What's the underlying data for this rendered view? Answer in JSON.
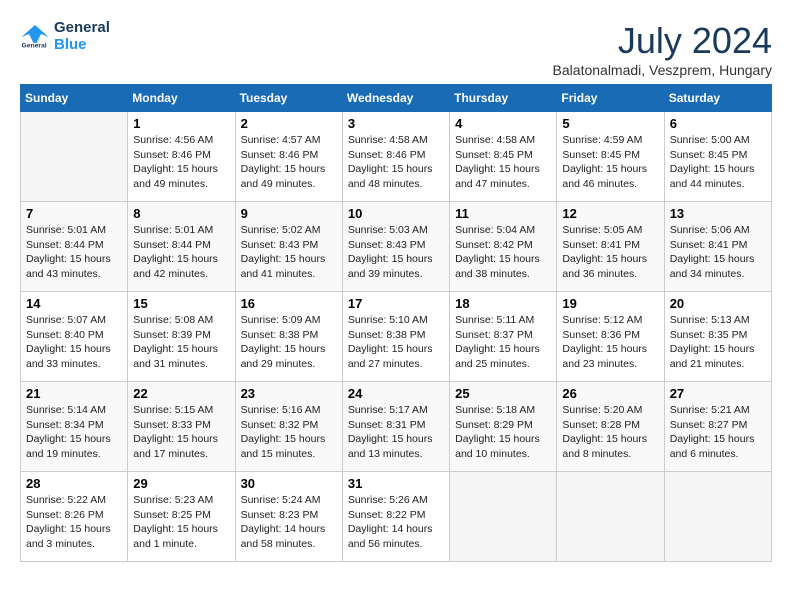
{
  "app": {
    "name": "GeneralBlue",
    "logo_color": "#2196F3"
  },
  "header": {
    "title": "July 2024",
    "subtitle": "Balatonalmadi, Veszprem, Hungary"
  },
  "calendar": {
    "days_of_week": [
      "Sunday",
      "Monday",
      "Tuesday",
      "Wednesday",
      "Thursday",
      "Friday",
      "Saturday"
    ],
    "weeks": [
      [
        {
          "day": "",
          "info": ""
        },
        {
          "day": "1",
          "info": "Sunrise: 4:56 AM\nSunset: 8:46 PM\nDaylight: 15 hours\nand 49 minutes."
        },
        {
          "day": "2",
          "info": "Sunrise: 4:57 AM\nSunset: 8:46 PM\nDaylight: 15 hours\nand 49 minutes."
        },
        {
          "day": "3",
          "info": "Sunrise: 4:58 AM\nSunset: 8:46 PM\nDaylight: 15 hours\nand 48 minutes."
        },
        {
          "day": "4",
          "info": "Sunrise: 4:58 AM\nSunset: 8:45 PM\nDaylight: 15 hours\nand 47 minutes."
        },
        {
          "day": "5",
          "info": "Sunrise: 4:59 AM\nSunset: 8:45 PM\nDaylight: 15 hours\nand 46 minutes."
        },
        {
          "day": "6",
          "info": "Sunrise: 5:00 AM\nSunset: 8:45 PM\nDaylight: 15 hours\nand 44 minutes."
        }
      ],
      [
        {
          "day": "7",
          "info": "Sunrise: 5:01 AM\nSunset: 8:44 PM\nDaylight: 15 hours\nand 43 minutes."
        },
        {
          "day": "8",
          "info": "Sunrise: 5:01 AM\nSunset: 8:44 PM\nDaylight: 15 hours\nand 42 minutes."
        },
        {
          "day": "9",
          "info": "Sunrise: 5:02 AM\nSunset: 8:43 PM\nDaylight: 15 hours\nand 41 minutes."
        },
        {
          "day": "10",
          "info": "Sunrise: 5:03 AM\nSunset: 8:43 PM\nDaylight: 15 hours\nand 39 minutes."
        },
        {
          "day": "11",
          "info": "Sunrise: 5:04 AM\nSunset: 8:42 PM\nDaylight: 15 hours\nand 38 minutes."
        },
        {
          "day": "12",
          "info": "Sunrise: 5:05 AM\nSunset: 8:41 PM\nDaylight: 15 hours\nand 36 minutes."
        },
        {
          "day": "13",
          "info": "Sunrise: 5:06 AM\nSunset: 8:41 PM\nDaylight: 15 hours\nand 34 minutes."
        }
      ],
      [
        {
          "day": "14",
          "info": "Sunrise: 5:07 AM\nSunset: 8:40 PM\nDaylight: 15 hours\nand 33 minutes."
        },
        {
          "day": "15",
          "info": "Sunrise: 5:08 AM\nSunset: 8:39 PM\nDaylight: 15 hours\nand 31 minutes."
        },
        {
          "day": "16",
          "info": "Sunrise: 5:09 AM\nSunset: 8:38 PM\nDaylight: 15 hours\nand 29 minutes."
        },
        {
          "day": "17",
          "info": "Sunrise: 5:10 AM\nSunset: 8:38 PM\nDaylight: 15 hours\nand 27 minutes."
        },
        {
          "day": "18",
          "info": "Sunrise: 5:11 AM\nSunset: 8:37 PM\nDaylight: 15 hours\nand 25 minutes."
        },
        {
          "day": "19",
          "info": "Sunrise: 5:12 AM\nSunset: 8:36 PM\nDaylight: 15 hours\nand 23 minutes."
        },
        {
          "day": "20",
          "info": "Sunrise: 5:13 AM\nSunset: 8:35 PM\nDaylight: 15 hours\nand 21 minutes."
        }
      ],
      [
        {
          "day": "21",
          "info": "Sunrise: 5:14 AM\nSunset: 8:34 PM\nDaylight: 15 hours\nand 19 minutes."
        },
        {
          "day": "22",
          "info": "Sunrise: 5:15 AM\nSunset: 8:33 PM\nDaylight: 15 hours\nand 17 minutes."
        },
        {
          "day": "23",
          "info": "Sunrise: 5:16 AM\nSunset: 8:32 PM\nDaylight: 15 hours\nand 15 minutes."
        },
        {
          "day": "24",
          "info": "Sunrise: 5:17 AM\nSunset: 8:31 PM\nDaylight: 15 hours\nand 13 minutes."
        },
        {
          "day": "25",
          "info": "Sunrise: 5:18 AM\nSunset: 8:29 PM\nDaylight: 15 hours\nand 10 minutes."
        },
        {
          "day": "26",
          "info": "Sunrise: 5:20 AM\nSunset: 8:28 PM\nDaylight: 15 hours\nand 8 minutes."
        },
        {
          "day": "27",
          "info": "Sunrise: 5:21 AM\nSunset: 8:27 PM\nDaylight: 15 hours\nand 6 minutes."
        }
      ],
      [
        {
          "day": "28",
          "info": "Sunrise: 5:22 AM\nSunset: 8:26 PM\nDaylight: 15 hours\nand 3 minutes."
        },
        {
          "day": "29",
          "info": "Sunrise: 5:23 AM\nSunset: 8:25 PM\nDaylight: 15 hours\nand 1 minute."
        },
        {
          "day": "30",
          "info": "Sunrise: 5:24 AM\nSunset: 8:23 PM\nDaylight: 14 hours\nand 58 minutes."
        },
        {
          "day": "31",
          "info": "Sunrise: 5:26 AM\nSunset: 8:22 PM\nDaylight: 14 hours\nand 56 minutes."
        },
        {
          "day": "",
          "info": ""
        },
        {
          "day": "",
          "info": ""
        },
        {
          "day": "",
          "info": ""
        }
      ]
    ]
  }
}
